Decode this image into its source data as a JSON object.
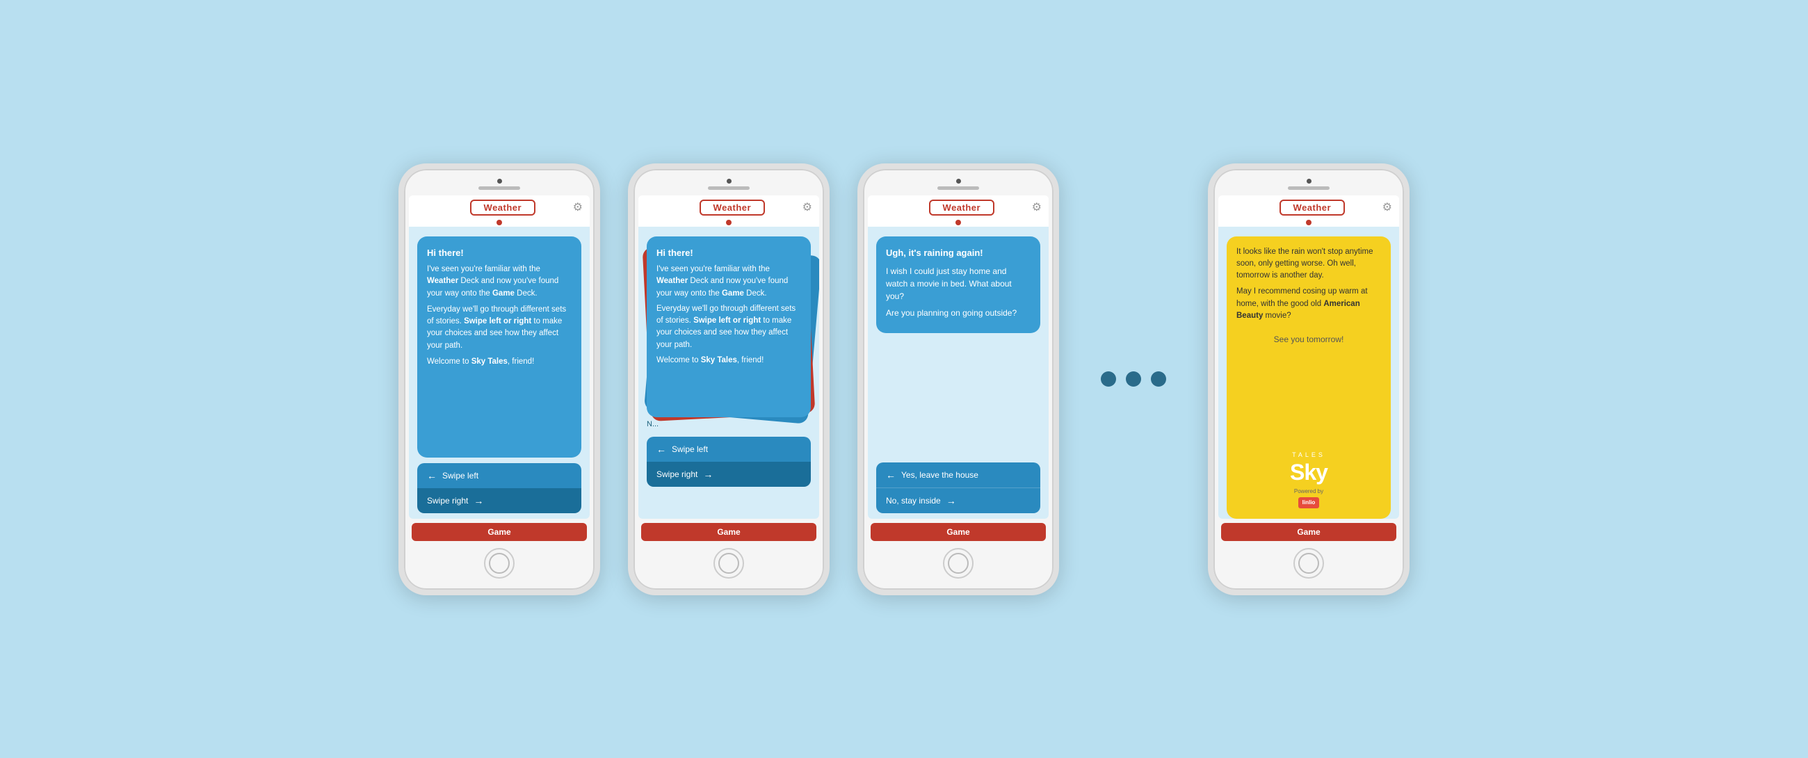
{
  "phones": [
    {
      "id": "phone1",
      "topTab": "Weather",
      "settingsIcon": "⚙",
      "card": {
        "title": "Hi there!",
        "paragraphs": [
          "I've seen you're familiar with the Weather Deck and now you've found your way onto the Game Deck.",
          "Everyday we'll go through different sets of stories. Swipe left or right to make your choices and see how they affect your path.",
          "Welcome to Sky Tales, friend!"
        ],
        "boldWords": [
          "Weather",
          "Game",
          "Swipe left or right",
          "Sky Tales,"
        ]
      },
      "swipeLeft": "Swipe left",
      "swipeRight": "Swipe right",
      "bottomTab": "Game"
    },
    {
      "id": "phone2",
      "topTab": "Weather",
      "settingsIcon": "⚙",
      "card": {
        "title": "Hi there!",
        "paragraphs": [
          "I've seen you're familiar with the Weather Deck and now you've found your way onto the Game Deck.",
          "Everyday we'll go through different sets of stories. Swipe left or right to make your choices and see how they affect your path.",
          "Welcome to Sky Tales, friend!"
        ]
      },
      "swipeLeft": "Swipe left",
      "swipeRight": "Swipe right",
      "bottomTab": "Game",
      "stacked": true
    },
    {
      "id": "phone3",
      "topTab": "Weather",
      "settingsIcon": "⚙",
      "card": {
        "title": "Ugh, it's raining again!",
        "paragraphs": [
          "I wish I could just stay home and watch a movie in bed. What about you?",
          "Are you planning on going outside?"
        ]
      },
      "choices": [
        {
          "label": "Yes, leave the house",
          "arrow": "←"
        },
        {
          "label": "No, stay inside",
          "arrow": "→"
        }
      ],
      "bottomTab": "Game"
    },
    {
      "id": "phone4",
      "topTab": "Weather",
      "settingsIcon": "⚙",
      "dots": 3,
      "card": {
        "paragraphs": [
          "It looks like the rain won't stop anytime soon, only getting worse. Oh well, tomorrow is another day.",
          "May I recommend cosing up warm at home, with the good old American Beauty movie?"
        ],
        "boldWords": [
          "American Beauty"
        ]
      },
      "seeTomorrow": "See you tomorrow!",
      "logoTales": "tales",
      "logoSky": "Sky",
      "poweredBy": "Powered by",
      "badge": "linlio",
      "bottomTab": "Game",
      "yellow": true
    }
  ]
}
